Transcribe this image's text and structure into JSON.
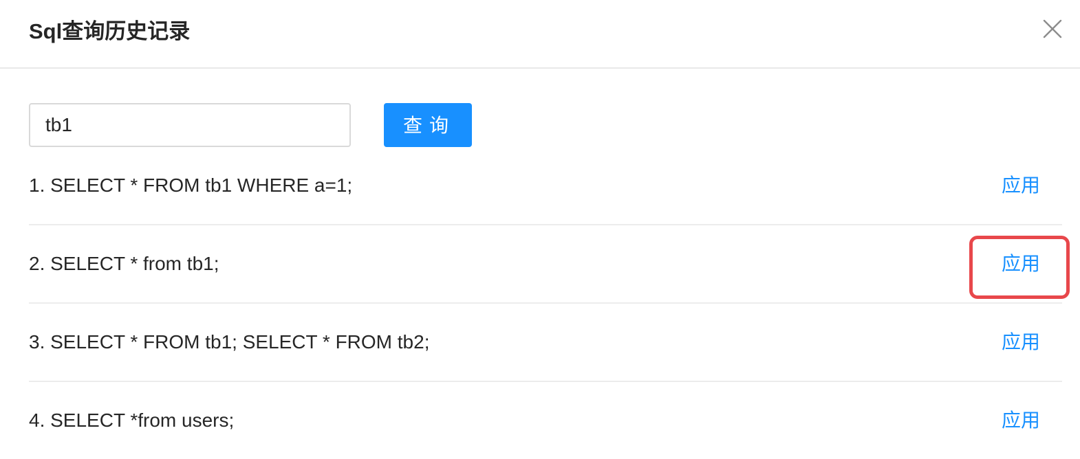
{
  "modal": {
    "title": "Sql查询历史记录",
    "close_icon": "close-icon"
  },
  "search": {
    "value": "tb1",
    "button_label": "查询"
  },
  "history": [
    {
      "text": "1. SELECT * FROM tb1 WHERE a=1;",
      "action": "应用"
    },
    {
      "text": "2. SELECT * from tb1;",
      "action": "应用"
    },
    {
      "text": "3. SELECT * FROM tb1; SELECT * FROM tb2;",
      "action": "应用"
    },
    {
      "text": "4. SELECT *from users;",
      "action": "应用"
    }
  ],
  "colors": {
    "primary": "#1890ff",
    "highlight": "#e8474b",
    "text": "#262626",
    "divider": "#ececec"
  }
}
